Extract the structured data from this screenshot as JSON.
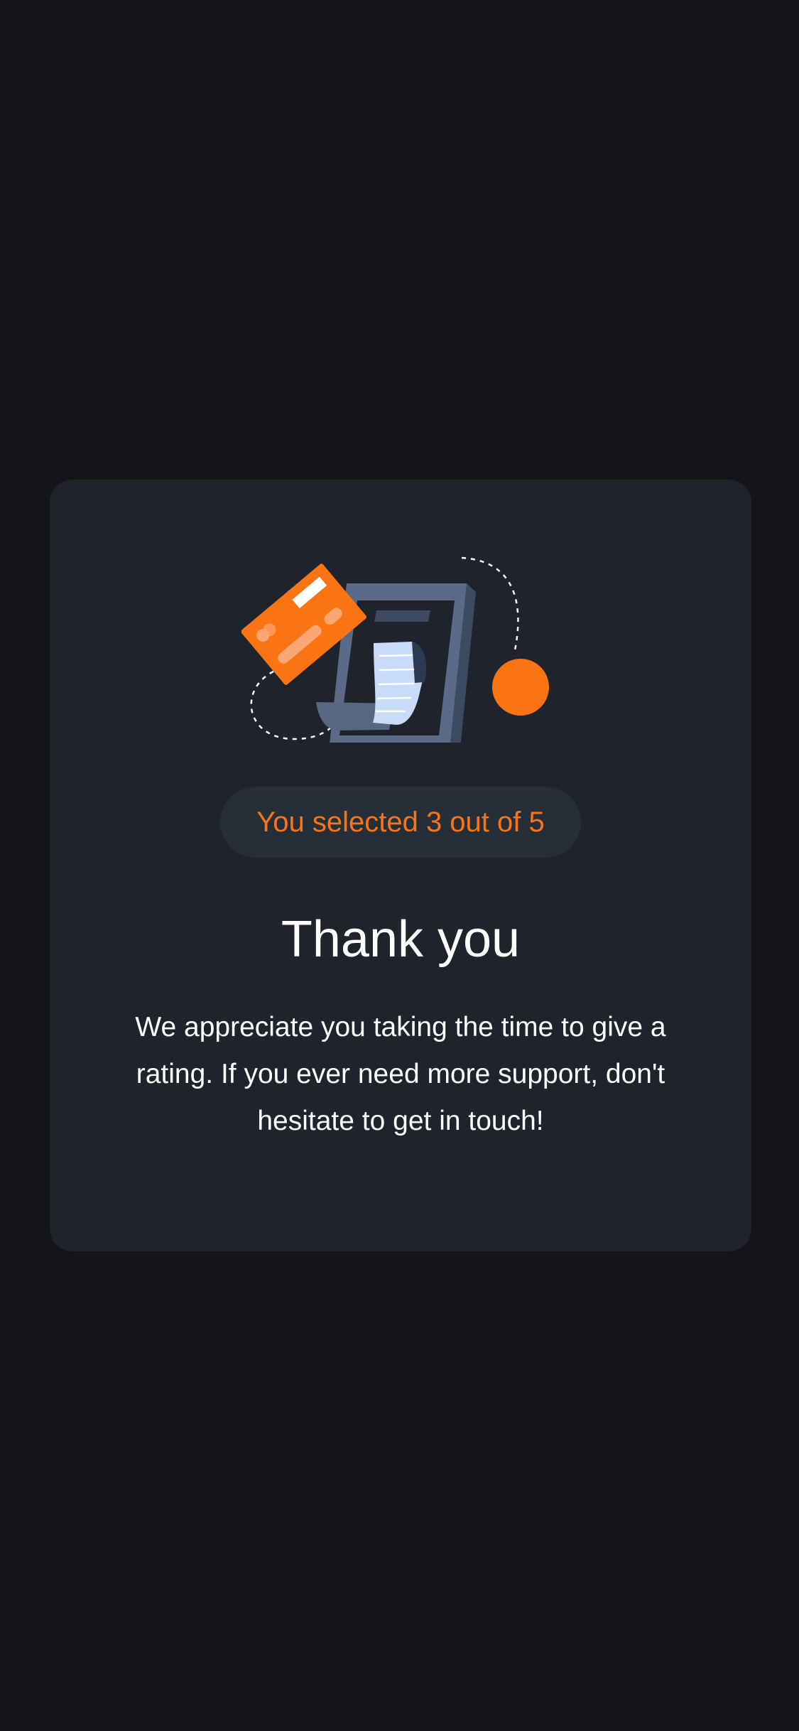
{
  "colors": {
    "page_background": "#131518",
    "card_background": "#1e232c",
    "pill_background": "#262e38",
    "accent": "#fb7413",
    "text_primary": "#ffffff"
  },
  "illustration": {
    "icon": "phone-payment-receipt-illustration"
  },
  "rating": {
    "selected_label": "You selected 3 out of 5"
  },
  "thank_you": {
    "title": "Thank you",
    "message": "We appreciate you taking the time to give a rating. If you ever need more support, don't hesitate to get in touch!"
  }
}
